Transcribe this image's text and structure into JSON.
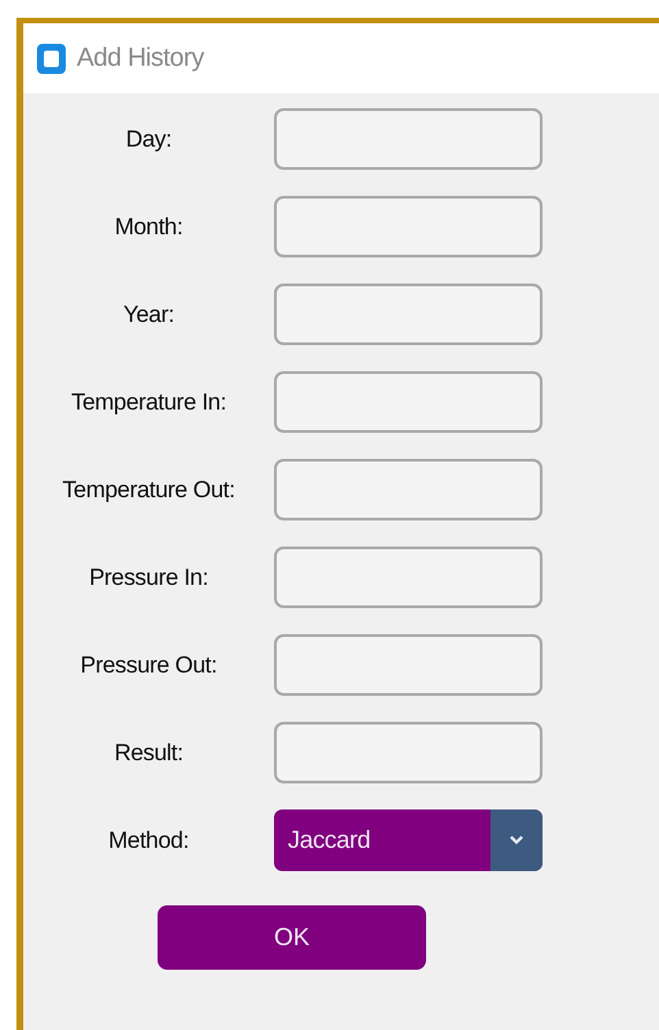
{
  "window": {
    "title": "Add History"
  },
  "fields": [
    {
      "label": "Day:"
    },
    {
      "label": "Month:"
    },
    {
      "label": "Year:"
    },
    {
      "label": "Temperature In:"
    },
    {
      "label": "Temperature Out:"
    },
    {
      "label": "Pressure In:"
    },
    {
      "label": "Pressure Out:"
    },
    {
      "label": "Result:"
    }
  ],
  "method": {
    "label": "Method:",
    "value": "Jaccard"
  },
  "buttons": [
    "OK"
  ]
}
